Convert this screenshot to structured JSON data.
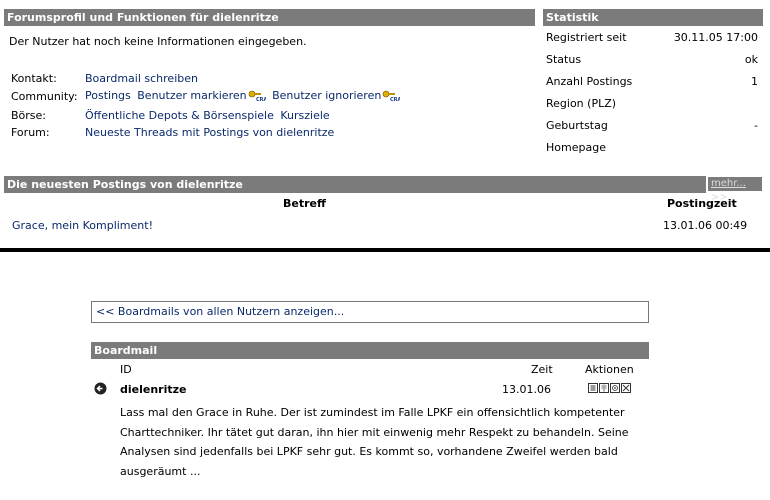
{
  "profile": {
    "title": "Forumsprofil und Funktionen für dielenritze",
    "no_info": "Der Nutzer hat noch keine Informationen eingegeben.",
    "rows": {
      "kontakt_label": "Kontakt:",
      "kontakt_link": "Boardmail schreiben",
      "community_label": "Community:",
      "community_postings": "Postings",
      "community_mark": "Benutzer markieren",
      "community_ignore": "Benutzer ignorieren",
      "boerse_label": "Börse:",
      "boerse_depots": "Öffentliche Depots & Börsenspiele",
      "boerse_kursziele": "Kursziele",
      "forum_label": "Forum:",
      "forum_link": "Neueste Threads mit Postings von dielenritze"
    }
  },
  "stats": {
    "title": "Statistik",
    "registered_label": "Registriert seit",
    "registered_value": "30.11.05 17:00",
    "status_label": "Status",
    "status_value": "ok",
    "postings_label": "Anzahl Postings",
    "postings_value": "1",
    "region_label": "Region (PLZ)",
    "region_value": "",
    "birthday_label": "Geburtstag",
    "birthday_value": "-",
    "homepage_label": "Homepage",
    "homepage_value": ""
  },
  "postings": {
    "title": "Die neuesten Postings von dielenritze",
    "more": "mehr... >>",
    "col_subject": "Betreff",
    "col_time": "Postingzeit",
    "rows": [
      {
        "subject": "Grace, mein Kompliment!",
        "time": "13.01.06 00:49"
      }
    ]
  },
  "boardmail": {
    "show_all_button": "<< Boardmails von allen Nutzern anzeigen...",
    "title": "Boardmail",
    "col_id": "ID",
    "col_time": "Zeit",
    "col_actions": "Aktionen",
    "message": {
      "sender": "dielenritze",
      "date": "13.01.06",
      "body": "Lass mal den Grace in Ruhe. Der ist zumindest im Falle LPKF ein offensichtlich kompetenter Charttechniker. Ihr tätet gut daran, ihn hier mit einwenig mehr Respekt zu behandeln. Seine Analysen sind jedenfalls bei LPKF sehr gut. Es kommt so, vorhandene Zweifel werden bald ausgeräumt ..."
    }
  },
  "colors": {
    "header_bg": "#7b7b7b",
    "link": "#0a2a6b"
  }
}
